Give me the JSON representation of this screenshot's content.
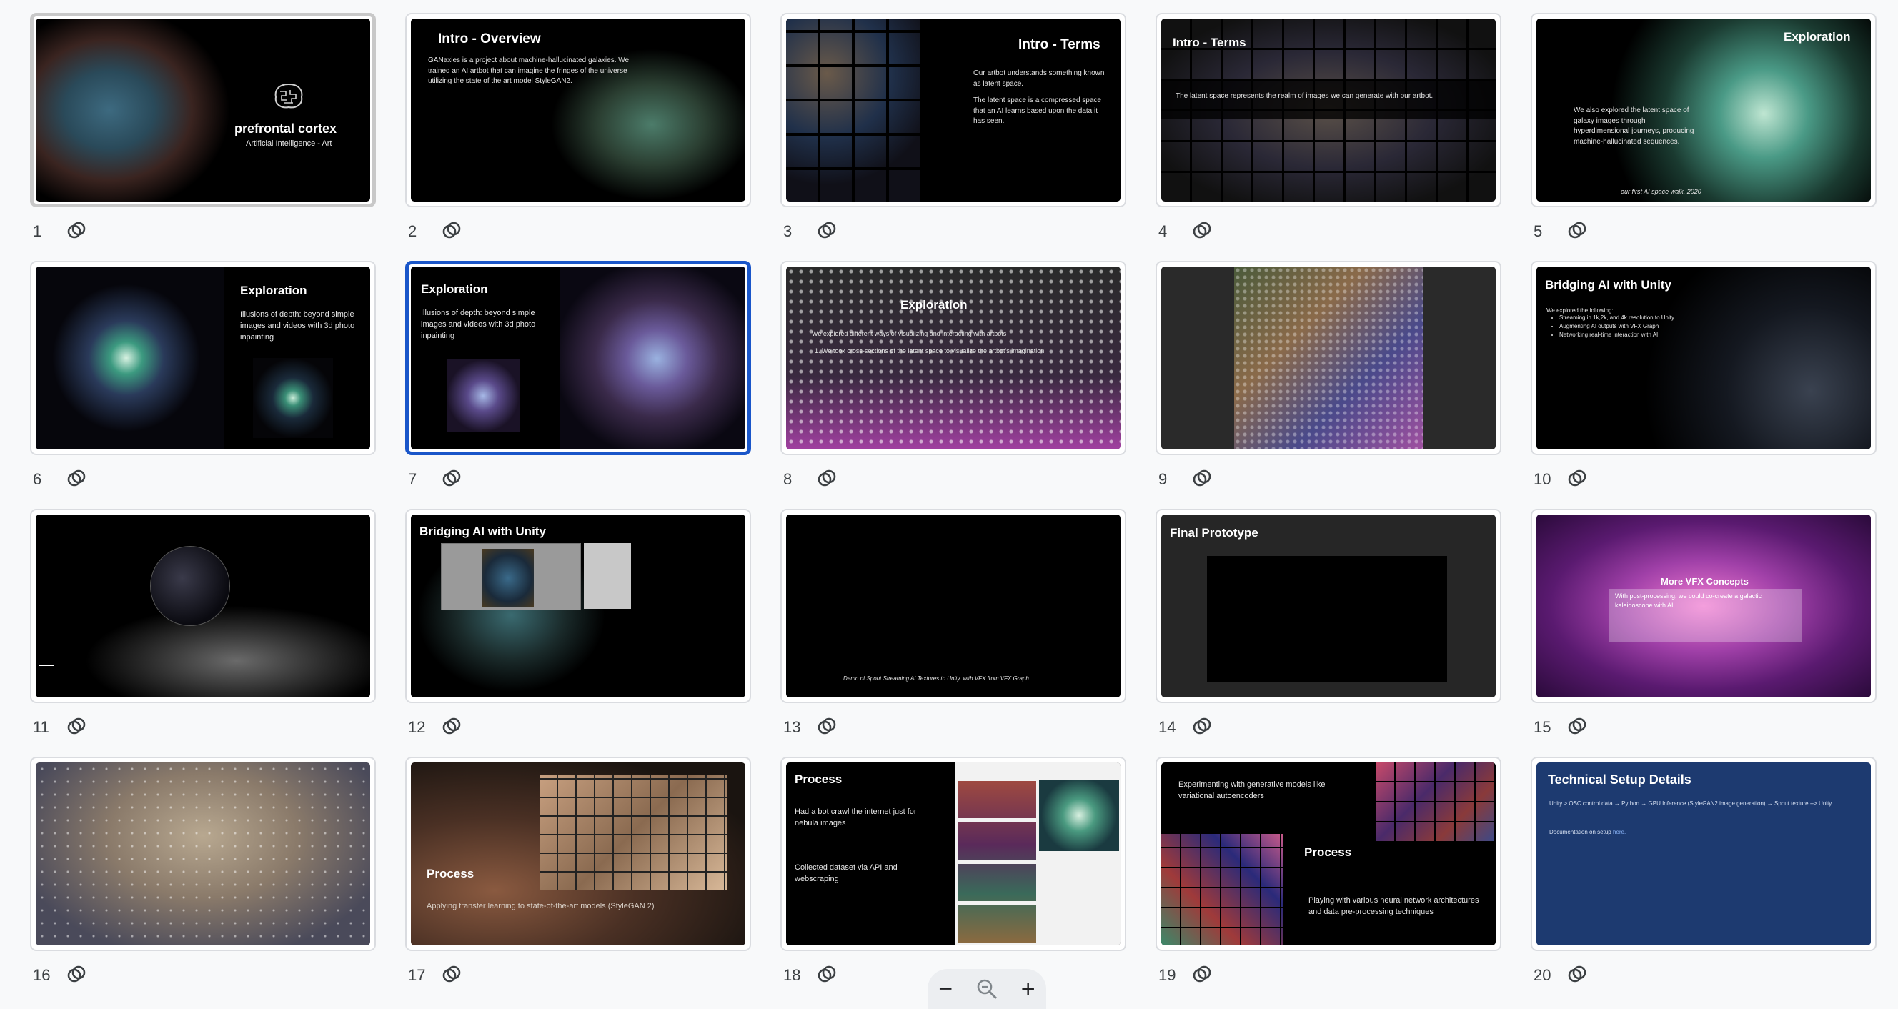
{
  "slides": [
    {
      "number": "1",
      "title": "prefrontal cortex",
      "body": "Artificial Intelligence - Art"
    },
    {
      "number": "2",
      "title": "Intro - Overview",
      "body": "GANaxies is a project about machine-hallucinated galaxies. We trained an AI artbot that can imagine the fringes of the universe utilizing the state of the art model StyleGAN2."
    },
    {
      "number": "3",
      "title": "Intro - Terms",
      "body": "Our artbot understands something known as latent space.",
      "body2": "The latent space is a compressed space that an AI learns based upon the data it has seen."
    },
    {
      "number": "4",
      "title": "Intro - Terms",
      "body": "The latent space represents the realm of images we can generate with our artbot."
    },
    {
      "number": "5",
      "title": "Exploration",
      "body": "We also explored the latent space of galaxy images through hyperdimensional journeys, producing machine-hallucinated sequences.",
      "caption": "our first AI space walk, 2020"
    },
    {
      "number": "6",
      "title": "Exploration",
      "body": "Illusions of depth: beyond simple images and videos with 3d photo inpainting"
    },
    {
      "number": "7",
      "title": "Exploration",
      "body": "Illusions of depth: beyond simple images and videos with 3d photo inpainting"
    },
    {
      "number": "8",
      "title": "Exploration",
      "body": "We explored different ways of visualizing and interacting with artbots",
      "body2": "1.    We took cross-sections of the latent space to visualize the artbot's imagination"
    },
    {
      "number": "9"
    },
    {
      "number": "10",
      "title": "Bridging AI with Unity",
      "body": "We explored the following:",
      "bullets": [
        "Streaming in 1k,2k, and 4k resolution to Unity",
        "Augmenting AI outputs with VFX Graph",
        "Networking real-time interaction with AI"
      ]
    },
    {
      "number": "11"
    },
    {
      "number": "12",
      "title": "Bridging AI with Unity"
    },
    {
      "number": "13",
      "caption": "Demo of Spout Streaming AI Textures to Unity, with VFX from VFX Graph"
    },
    {
      "number": "14",
      "title": "Final Prototype"
    },
    {
      "number": "15",
      "title": "More VFX Concepts",
      "body": "With post-processing, we could co-create a galactic kaleidoscope with AI."
    },
    {
      "number": "16"
    },
    {
      "number": "17",
      "title": "Process",
      "body": "Applying transfer learning to state-of-the-art models (StyleGAN 2)"
    },
    {
      "number": "18",
      "title": "Process",
      "body": "Had a bot crawl the internet just for nebula images",
      "body2": "Collected dataset via API and webscraping"
    },
    {
      "number": "19",
      "title": "Process",
      "body": "Experimenting with generative models like variational autoencoders",
      "body2": "Playing with various neural network architectures and data pre-processing techniques"
    },
    {
      "number": "20",
      "title": "Technical Setup Details",
      "body": "Unity > OSC control data → Python → GPU Inference (StyleGAN2 image generation) → Spout texture --> Unity",
      "body2": "Documentation on setup ",
      "link": "here."
    }
  ],
  "zoom": {
    "out": "−",
    "icon": "zoom-icon",
    "in": "+"
  },
  "colors": {
    "selected": "#1a56c9",
    "slide20_bg": "#1d3a70",
    "link": "#8ab4f8"
  }
}
